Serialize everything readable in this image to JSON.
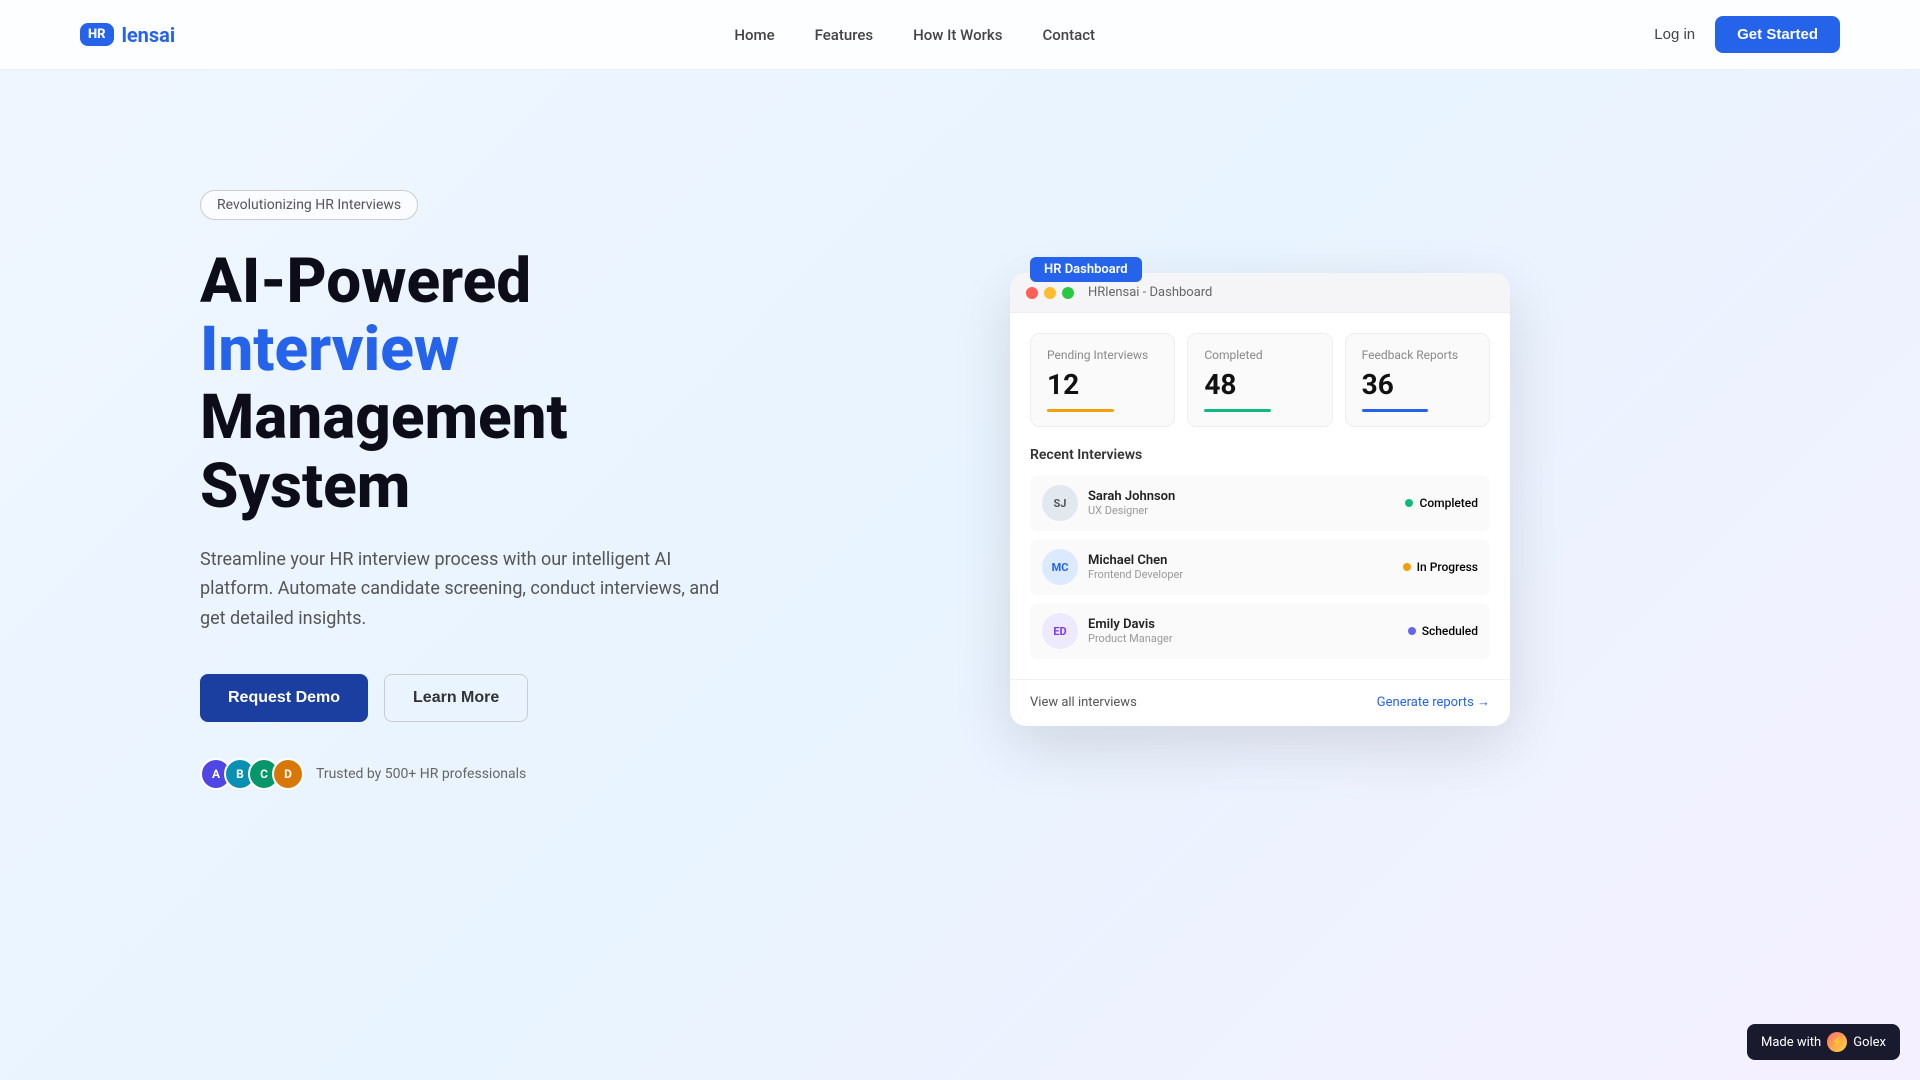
{
  "nav": {
    "logo_badge": "HR",
    "logo_text": "lens",
    "logo_accent": "ai",
    "links": [
      {
        "label": "Home",
        "id": "home"
      },
      {
        "label": "Features",
        "id": "features"
      },
      {
        "label": "How It Works",
        "id": "how-it-works"
      },
      {
        "label": "Contact",
        "id": "contact"
      }
    ],
    "login_label": "Log in",
    "get_started_label": "Get Started"
  },
  "hero": {
    "tag": "Revolutionizing HR Interviews",
    "title_line1": "AI-Powered",
    "title_line2": "Interview",
    "title_line3": "Management",
    "title_line4": "System",
    "subtitle": "Streamline your HR interview process with our intelligent AI platform. Automate candidate screening, conduct interviews, and get detailed insights.",
    "btn_primary": "Request Demo",
    "btn_secondary": "Learn More",
    "avatars": [
      {
        "initials": "A",
        "color": "#4f46e5"
      },
      {
        "initials": "B",
        "color": "#0891b2"
      },
      {
        "initials": "C",
        "color": "#059669"
      },
      {
        "initials": "D",
        "color": "#d97706"
      }
    ],
    "trust_text": "Trusted by 500+ HR professionals"
  },
  "dashboard": {
    "tag": "HR Dashboard",
    "titlebar_text": "HRlensai - Dashboard",
    "stats": [
      {
        "label": "Pending Interviews",
        "value": "12",
        "bar_class": "bar-yellow"
      },
      {
        "label": "Completed",
        "value": "48",
        "bar_class": "bar-green"
      },
      {
        "label": "Feedback Reports",
        "value": "36",
        "bar_class": "bar-blue"
      }
    ],
    "recent_title": "Recent Interviews",
    "interviews": [
      {
        "initials": "SJ",
        "name": "Sarah Johnson",
        "role": "UX Designer",
        "status": "Completed",
        "status_class": "dot-completed",
        "status_color": "#10b981"
      },
      {
        "initials": "MC",
        "name": "Michael Chen",
        "role": "Frontend Developer",
        "status": "In Progress",
        "status_class": "dot-inprogress",
        "status_color": "#f59e0b"
      },
      {
        "initials": "ED",
        "name": "Emily Davis",
        "role": "Product Manager",
        "status": "Scheduled",
        "status_class": "dot-scheduled",
        "status_color": "#6366f1"
      }
    ],
    "footer_left": "View all interviews",
    "footer_right": "Generate reports →"
  },
  "golex": {
    "label": "Made with",
    "brand": "Golex"
  }
}
